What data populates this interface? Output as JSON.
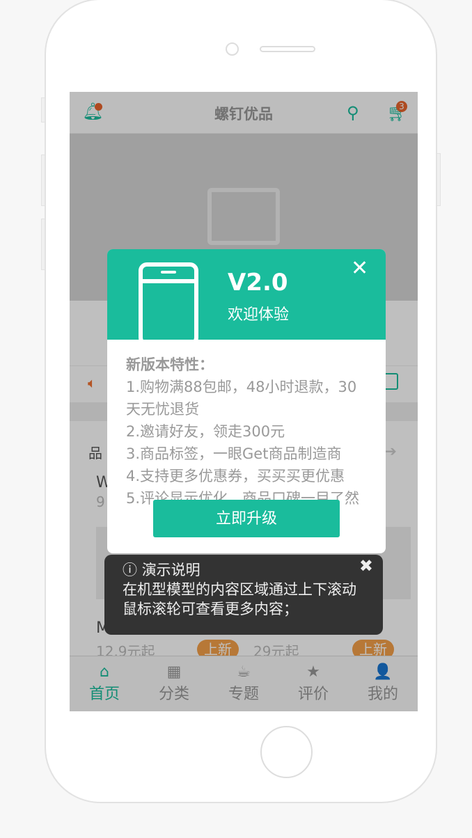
{
  "header": {
    "title": "螺钉优品",
    "cart_count": "3"
  },
  "notice": {
    "icon": "speaker-icon"
  },
  "section": {
    "title_fragment": "品",
    "item1_name_fragment": "W",
    "item1_price_fragment": "9",
    "item2_name_fragment": "M",
    "item_price_1": "12.9元起",
    "item_price_2": "29元起",
    "badge": "上新"
  },
  "tabs": [
    {
      "label": "首页",
      "icon": "⌂"
    },
    {
      "label": "分类",
      "icon": "▦"
    },
    {
      "label": "专题",
      "icon": "☕"
    },
    {
      "label": "评价",
      "icon": "★"
    },
    {
      "label": "我的",
      "icon": "👤"
    }
  ],
  "modal": {
    "version": "V2.0",
    "welcome": "欢迎体验",
    "features_title": "新版本特性：",
    "features": [
      "1.购物满88包邮，48小时退款，30天无忧退货",
      "2.邀请好友，领走300元",
      "3.商品标签，一眼Get商品制造商",
      "4.支持更多优惠券，买买买更优惠",
      "5.评论显示优化，商品口碑一目了然"
    ],
    "upgrade_label": "立即升级"
  },
  "tip": {
    "title": "演示说明",
    "text": "在机型模型的内容区域通过上下滚动鼠标滚轮可查看更多内容；"
  },
  "colors": {
    "accent": "#1abc9c",
    "badge": "#e8642c",
    "tag": "#f5a04a"
  }
}
